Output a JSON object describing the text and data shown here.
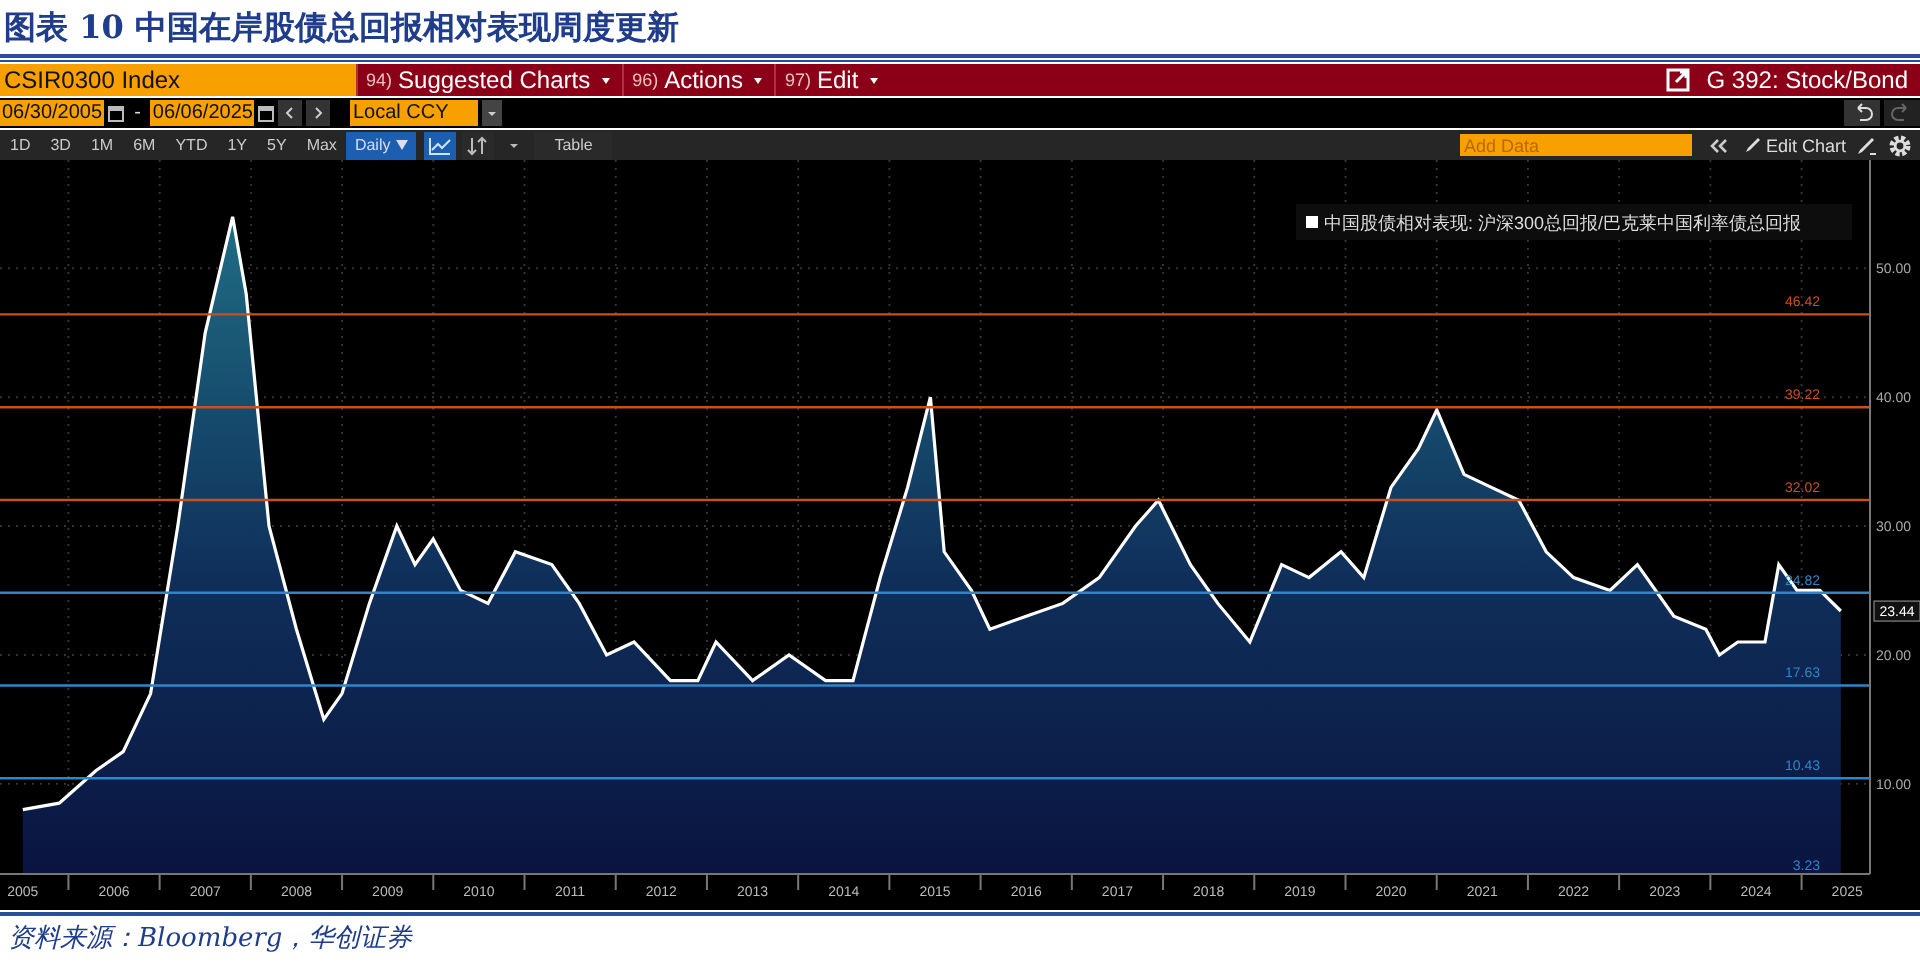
{
  "title": "图表 10 中国在岸股债总回报相对表现周度更新",
  "header": {
    "security": "CSIR0300 Index",
    "menus": [
      {
        "code": "94)",
        "label": "Suggested Charts"
      },
      {
        "code": "96)",
        "label": "Actions"
      },
      {
        "code": "97)",
        "label": "Edit"
      }
    ],
    "chart_name": "G 392: Stock/Bond"
  },
  "date_row": {
    "start": "06/30/2005",
    "separator": "-",
    "end": "06/06/2025",
    "currency": "Local CCY"
  },
  "toolbar": {
    "ranges": [
      "1D",
      "3D",
      "1M",
      "6M",
      "YTD",
      "1Y",
      "5Y",
      "Max"
    ],
    "frequency": "Daily",
    "chart_types": [
      {
        "kind": "line",
        "selected": true
      },
      {
        "kind": "bar",
        "selected": false
      }
    ],
    "table": "Table",
    "add_data": {
      "placeholder": "Add Data"
    },
    "edit_chart": "Edit Chart"
  },
  "chart": {
    "chart_data": {
      "type": "area",
      "grid": true,
      "series": [
        {
          "name": "中国股债相对表现: 沪深300总回报/巴克莱中国利率债总回报",
          "color": "#ffffff",
          "values": [
            8,
            8.5,
            11,
            12.5,
            17,
            30,
            45,
            54,
            48,
            30,
            22,
            15,
            17,
            24,
            30,
            27,
            29,
            25,
            24,
            28,
            27,
            24,
            20,
            21,
            18,
            18,
            21,
            18,
            20,
            18,
            18,
            26,
            33,
            40,
            28,
            25,
            22,
            23,
            24,
            26,
            30,
            32,
            27,
            24,
            21,
            27,
            26,
            28,
            26,
            33,
            36,
            39,
            34,
            33,
            32,
            28,
            26,
            25,
            27,
            23,
            22,
            20,
            21,
            21,
            27,
            25,
            25,
            23.4
          ]
        }
      ],
      "x": [
        2005.5,
        2005.9,
        2006.3,
        2006.6,
        2006.9,
        2007.2,
        2007.5,
        2007.8,
        2007.95,
        2008.2,
        2008.5,
        2008.8,
        2009.0,
        2009.3,
        2009.6,
        2009.8,
        2010.0,
        2010.3,
        2010.6,
        2010.9,
        2011.3,
        2011.6,
        2011.9,
        2012.2,
        2012.6,
        2012.9,
        2013.1,
        2013.5,
        2013.9,
        2014.3,
        2014.6,
        2014.9,
        2015.2,
        2015.45,
        2015.6,
        2015.9,
        2016.1,
        2016.5,
        2016.9,
        2017.3,
        2017.7,
        2017.95,
        2018.3,
        2018.6,
        2018.95,
        2019.3,
        2019.6,
        2019.95,
        2020.2,
        2020.5,
        2020.8,
        2021.0,
        2021.3,
        2021.6,
        2021.9,
        2022.2,
        2022.5,
        2022.9,
        2023.2,
        2023.6,
        2023.95,
        2024.1,
        2024.3,
        2024.6,
        2024.75,
        2024.95,
        2025.2,
        2025.43
      ],
      "xlim": [
        2005.25,
        2025.75
      ],
      "ylim": [
        3,
        58.4
      ],
      "xticks": [
        {
          "value": 2005.5,
          "label": "2005"
        },
        {
          "value": 2006.5,
          "label": "2006"
        },
        {
          "value": 2007.5,
          "label": "2007"
        },
        {
          "value": 2008.5,
          "label": "2008"
        },
        {
          "value": 2009.5,
          "label": "2009"
        },
        {
          "value": 2010.5,
          "label": "2010"
        },
        {
          "value": 2011.5,
          "label": "2011"
        },
        {
          "value": 2012.5,
          "label": "2012"
        },
        {
          "value": 2013.5,
          "label": "2013"
        },
        {
          "value": 2014.5,
          "label": "2014"
        },
        {
          "value": 2015.5,
          "label": "2015"
        },
        {
          "value": 2016.5,
          "label": "2016"
        },
        {
          "value": 2017.5,
          "label": "2017"
        },
        {
          "value": 2018.5,
          "label": "2018"
        },
        {
          "value": 2019.5,
          "label": "2019"
        },
        {
          "value": 2020.5,
          "label": "2020"
        },
        {
          "value": 2021.5,
          "label": "2021"
        },
        {
          "value": 2022.5,
          "label": "2022"
        },
        {
          "value": 2023.5,
          "label": "2023"
        },
        {
          "value": 2024.5,
          "label": "2024"
        },
        {
          "value": 2025.5,
          "label": "2025"
        }
      ],
      "yticks": [
        {
          "value": 10,
          "label": "10.00"
        },
        {
          "value": 20,
          "label": "20.00"
        },
        {
          "value": 30,
          "label": "30.00"
        },
        {
          "value": 40,
          "label": "40.00"
        },
        {
          "value": 50,
          "label": "50.00"
        }
      ],
      "ref_lines": [
        {
          "axis": "y",
          "value": 46.42,
          "label": "46.42",
          "color": "#c8501e"
        },
        {
          "axis": "y",
          "value": 39.22,
          "label": "39.22",
          "color": "#c8501e"
        },
        {
          "axis": "y",
          "value": 32.02,
          "label": "32.02",
          "color": "#c8501e"
        },
        {
          "axis": "y",
          "value": 24.82,
          "label": "24.82",
          "color": "#2f86c8"
        },
        {
          "axis": "y",
          "value": 17.63,
          "label": "17.63",
          "color": "#2f86c8"
        },
        {
          "axis": "y",
          "value": 10.43,
          "label": "10.43",
          "color": "#2f86c8"
        }
      ],
      "annotations": [
        "3.23",
        "23.44"
      ]
    }
  },
  "source": "资料来源：Bloomberg，华创证券"
}
